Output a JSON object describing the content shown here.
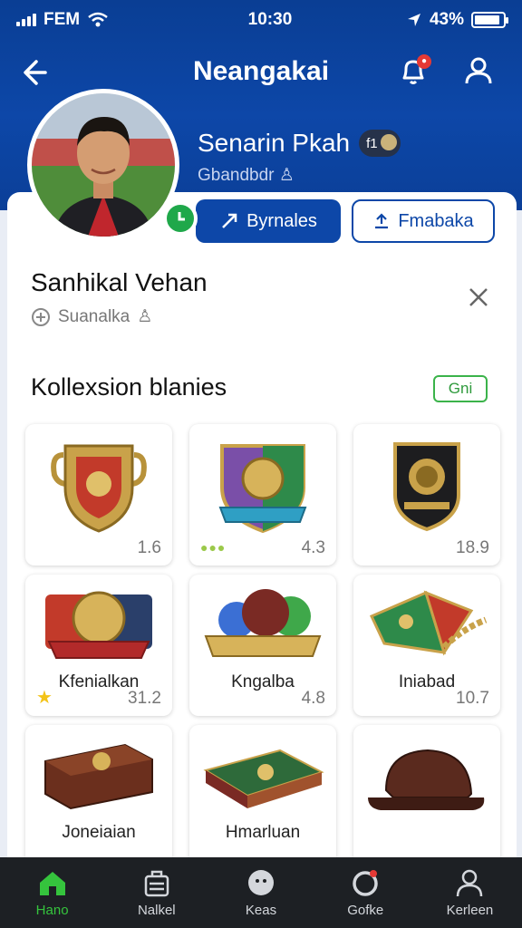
{
  "status_bar": {
    "carrier": "FEM",
    "time": "10:30",
    "battery": "43%"
  },
  "header": {
    "title": "Neangakai"
  },
  "profile": {
    "name": "Senarin Pkah",
    "badge": "f1",
    "subtitle": "Gbandbdr"
  },
  "actions": {
    "primary_label": "Byrnales",
    "secondary_label": "Fmabaka"
  },
  "user": {
    "title": "Sanhikal Vehan",
    "meta": "Suanalka"
  },
  "collection": {
    "title": "Kollexsion blanies",
    "pill": "Gni",
    "items": [
      {
        "label": "",
        "value": "1.6",
        "marker": ""
      },
      {
        "label": "",
        "value": "4.3",
        "marker": "dots"
      },
      {
        "label": "",
        "value": "18.9",
        "marker": ""
      },
      {
        "label": "Kfenialkan",
        "value": "31.2",
        "marker": "star"
      },
      {
        "label": "Kngalba",
        "value": "4.8",
        "marker": ""
      },
      {
        "label": "Iniabad",
        "value": "10.7",
        "marker": ""
      },
      {
        "label": "Joneiaian",
        "value": "",
        "marker": ""
      },
      {
        "label": "Hmarluan",
        "value": "",
        "marker": ""
      },
      {
        "label": "",
        "value": "",
        "marker": ""
      }
    ]
  },
  "bottom_nav": [
    {
      "label": "Hano",
      "icon": "home-icon",
      "active": true
    },
    {
      "label": "Nalkel",
      "icon": "briefcase-icon",
      "active": false
    },
    {
      "label": "Keas",
      "icon": "ball-icon",
      "active": false
    },
    {
      "label": "Gofke",
      "icon": "ring-icon",
      "active": false
    },
    {
      "label": "Kerleen",
      "icon": "person-icon",
      "active": false
    }
  ],
  "colors": {
    "primary": "#0d47a8",
    "accent_green": "#35c43d",
    "nav_bg": "#1d2024"
  }
}
